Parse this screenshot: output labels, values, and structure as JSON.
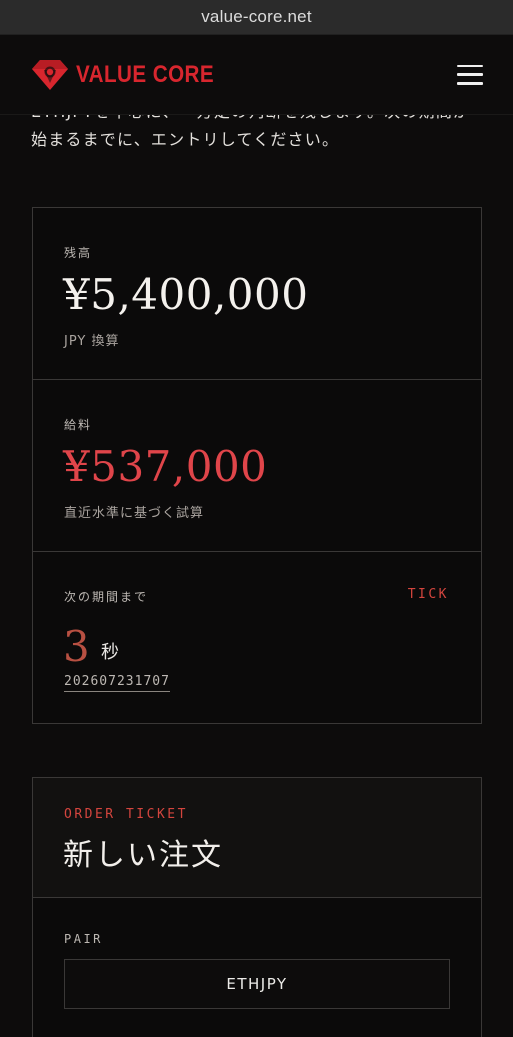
{
  "browser": {
    "url": "value-core.net"
  },
  "header": {
    "logo_text": "VALUE CORE",
    "logo_icon": "lion-diamond-icon",
    "menu_icon": "hamburger-icon"
  },
  "intro": {
    "line1": "ETHJPYを中心に、一方定の判断を残します。次の期間が",
    "line2": "始まるまでに、エントリしてください。"
  },
  "stats": {
    "balance": {
      "label": "残高",
      "value": "¥5,400,000",
      "note": "JPY 換算"
    },
    "salary": {
      "label": "給料",
      "value": "¥537,000",
      "note": "直近水準に基づく試算"
    },
    "next_period": {
      "label": "次の期間まで",
      "tick": "TICK",
      "count": "3",
      "unit": "秒",
      "period_id": "202607231707"
    }
  },
  "order_ticket": {
    "eyebrow": "ORDER TICKET",
    "title": "新しい注文",
    "pair_label": "PAIR",
    "pair_value": "ETHJPY"
  },
  "colors": {
    "accent_red": "#d8262e",
    "salary_red": "#e0454a",
    "countdown": "#b85042",
    "background": "#0d0c0c"
  }
}
